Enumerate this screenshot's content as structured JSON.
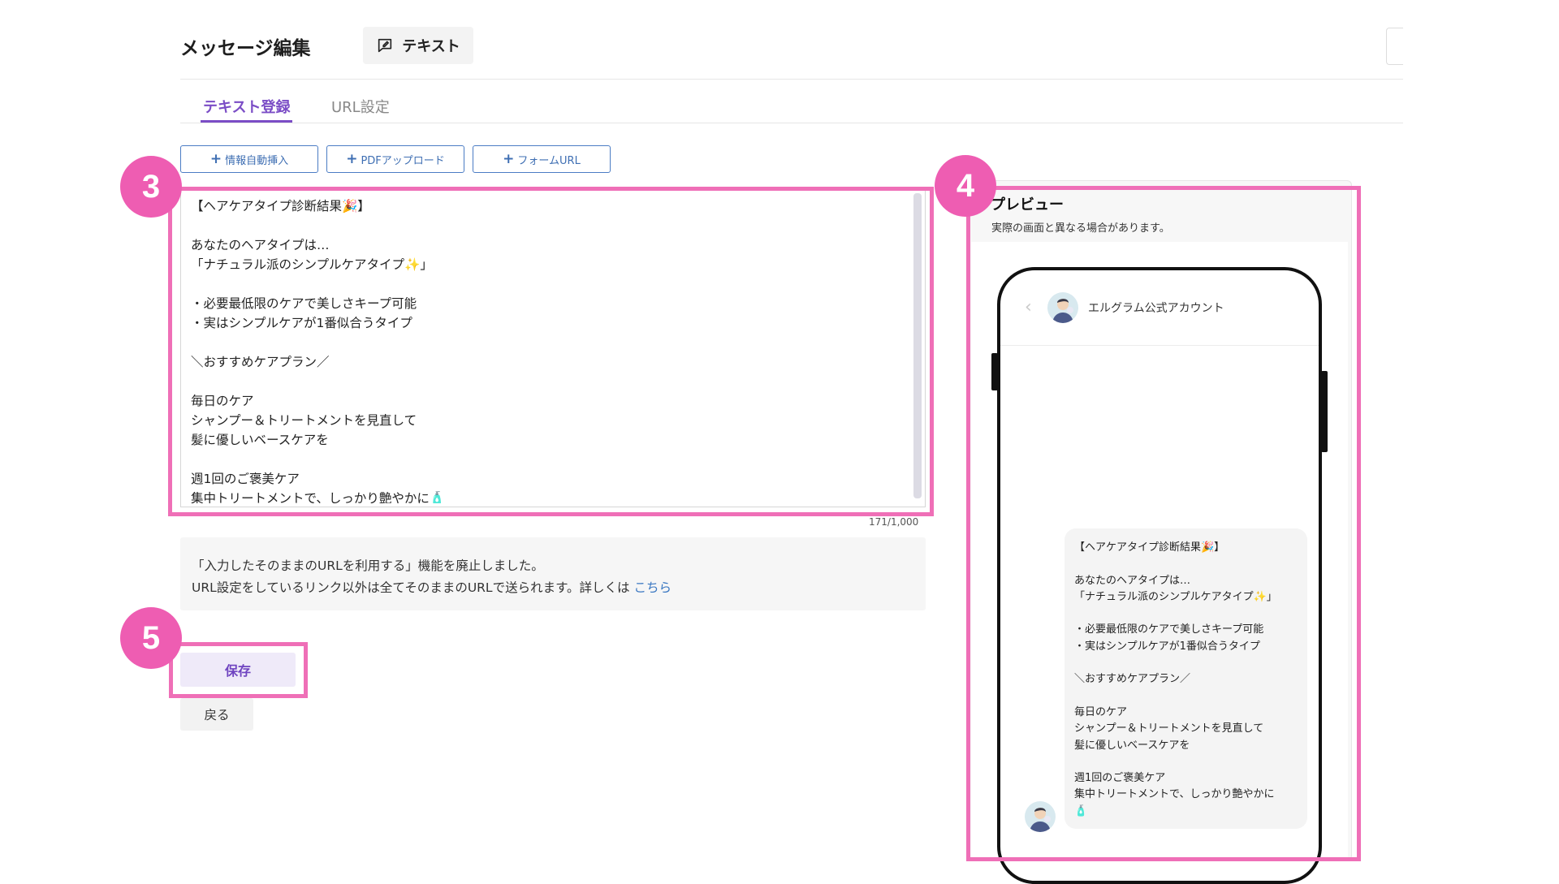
{
  "header": {
    "title": "メッセージ編集",
    "type_label": "テキスト",
    "type_icon": "chat-bubble-edit-icon"
  },
  "tabs": [
    {
      "label": "テキスト登録",
      "active": true
    },
    {
      "label": "URL設定",
      "active": false
    }
  ],
  "insert_buttons": [
    {
      "label": "情報自動挿入"
    },
    {
      "label": "PDFアップロード"
    },
    {
      "label": "フォームURL"
    }
  ],
  "editor": {
    "text": "【ヘアケアタイプ診断結果🎉】\n\nあなたのヘアタイプは…\n「ナチュラル派のシンプルケアタイプ✨」\n\n・必要最低限のケアで美しさキープ可能\n・実はシンプルケアが1番似合うタイプ\n\n＼おすすめケアプラン／\n\n毎日のケア\nシャンプー＆トリートメントを見直して\n髪に優しいベースケアを\n\n週1回のご褒美ケア\n集中トリートメントで、しっかり艶やかに🧴",
    "counter": "171/1,000"
  },
  "notice": {
    "line1": "「入力したそのままのURLを利用する」機能を廃止しました。",
    "line2": "URL設定をしているリンク以外は全てそのままのURLで送られます。詳しくは",
    "link": "こちら"
  },
  "actions": {
    "save": "保存",
    "back": "戻る"
  },
  "preview": {
    "title": "プレビュー",
    "subtitle": "実際の画面と異なる場合があります。",
    "account_name": "エルグラム公式アカウント",
    "message": "【ヘアケアタイプ診断結果🎉】\n\nあなたのヘアタイプは…\n「ナチュラル派のシンプルケアタイプ✨」\n\n・必要最低限のケアで美しさキープ可能\n・実はシンプルケアが1番似合うタイプ\n\n＼おすすめケアプラン／\n\n毎日のケア\nシャンプー＆トリートメントを見直して\n髪に優しいベースケアを\n\n週1回のご褒美ケア\n集中トリートメントで、しっかり艶やかに\n🧴"
  },
  "annotations": {
    "marker_3": "3",
    "marker_4": "4",
    "marker_5": "5",
    "highlight_color": "#ef6fb7"
  },
  "colors": {
    "accent": "#7b4dc6",
    "link": "#3b78c2",
    "insert_button": "#4b7cc4"
  }
}
